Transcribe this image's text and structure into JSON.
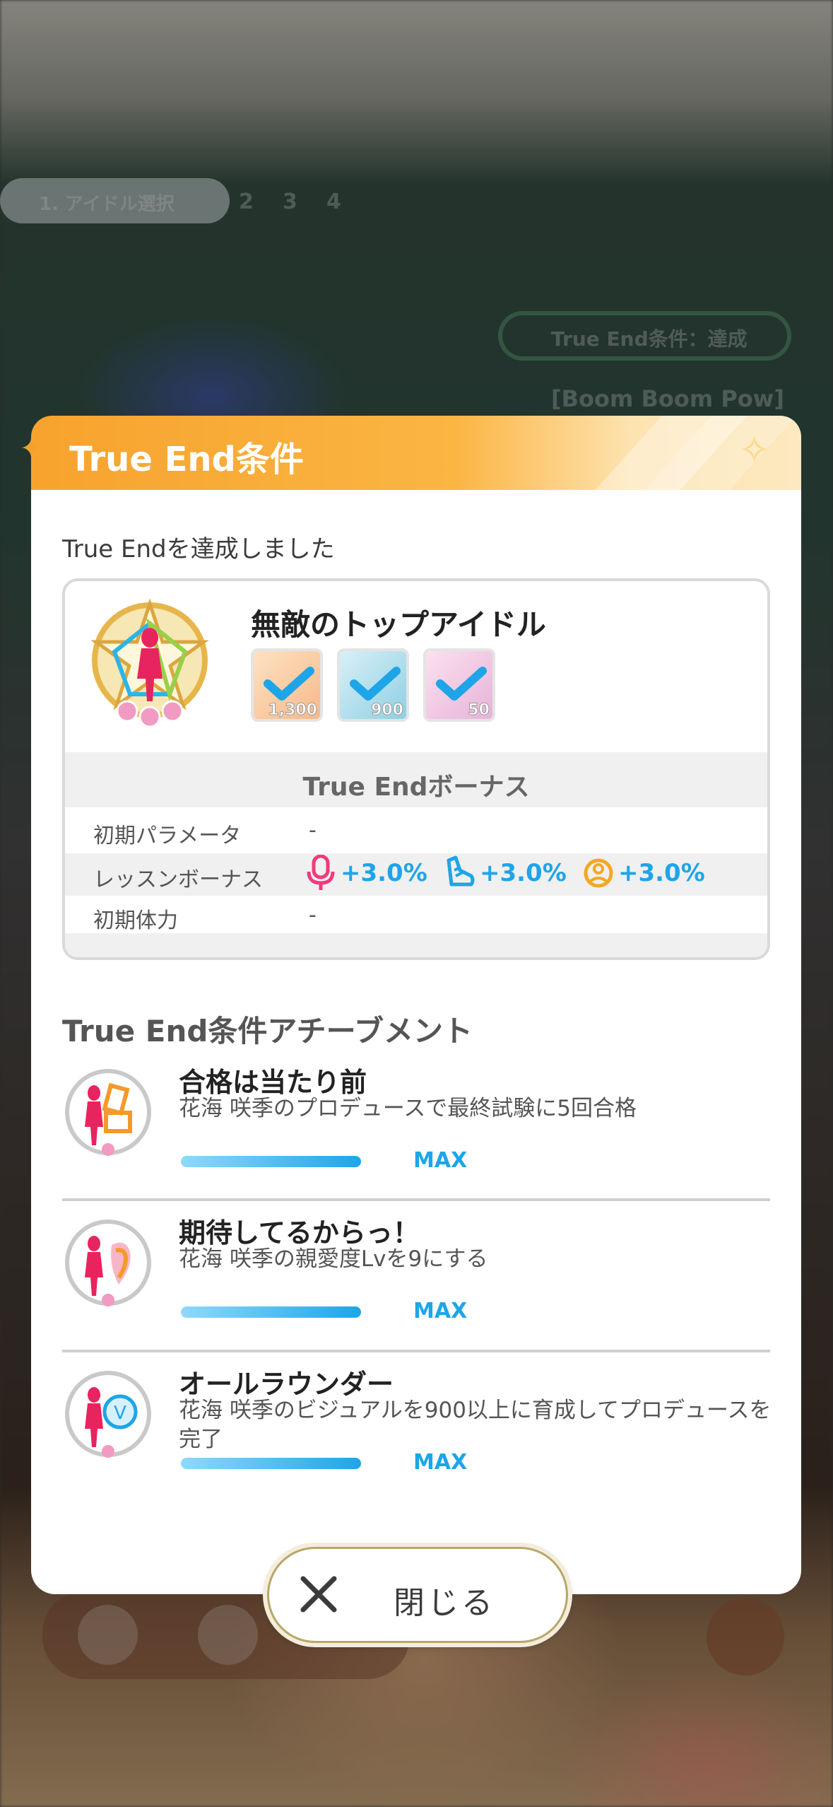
{
  "dialog": {
    "title": "True End条件",
    "achieved_text": "True Endを達成しました",
    "close_label": "閉じる"
  },
  "card": {
    "name": "無敵のトップアイドル",
    "stamps": [
      {
        "icon": "vocal-stamp-icon",
        "value": "1,300",
        "color": "#f6c38a"
      },
      {
        "icon": "dance-stamp-icon",
        "value": "900",
        "color": "#9fd4e6"
      },
      {
        "icon": "visual-stamp-icon",
        "value": "50",
        "color": "#f2b9d4"
      }
    ],
    "bonus_title": "True Endボーナス",
    "rows": {
      "initial_params_label": "初期パラメータ",
      "initial_params_value": "-",
      "lesson_bonus_label": "レッスンボーナス",
      "lesson_bonus": [
        {
          "icon": "vocal-mic-icon",
          "value": "+3.0%",
          "color": "#ee3b7e"
        },
        {
          "icon": "dance-shoe-icon",
          "value": "+3.0%",
          "color": "#1ea5e8"
        },
        {
          "icon": "visual-face-icon",
          "value": "+3.0%",
          "color": "#f3a825"
        }
      ],
      "initial_stamina_label": "初期体力",
      "initial_stamina_value": "-"
    }
  },
  "achievements": {
    "title": "True End条件アチーブメント",
    "items": [
      {
        "name": "合格は当たり前",
        "desc": "花海 咲季のプロデュースで最終試験に5回合格",
        "progress_label": "MAX",
        "progress": 1.0
      },
      {
        "name": "期待してるからっ！",
        "desc": "花海 咲季の親愛度Lvを9にする",
        "progress_label": "MAX",
        "progress": 1.0
      },
      {
        "name": "オールラウンダー",
        "desc": "花海 咲季のビジュアルを900以上に育成してプロデュースを完了",
        "progress_label": "MAX",
        "progress": 1.0
      }
    ]
  },
  "background": {
    "tab_label": "1. アイドル選択",
    "steps": [
      "2",
      "3",
      "4"
    ],
    "badge_label": "True End条件：達成",
    "song_label": "[Boom Boom Pow]"
  },
  "colors": {
    "accent_orange": "#f7a32e",
    "accent_blue": "#1ea5e8",
    "pink": "#ee3b7e"
  }
}
